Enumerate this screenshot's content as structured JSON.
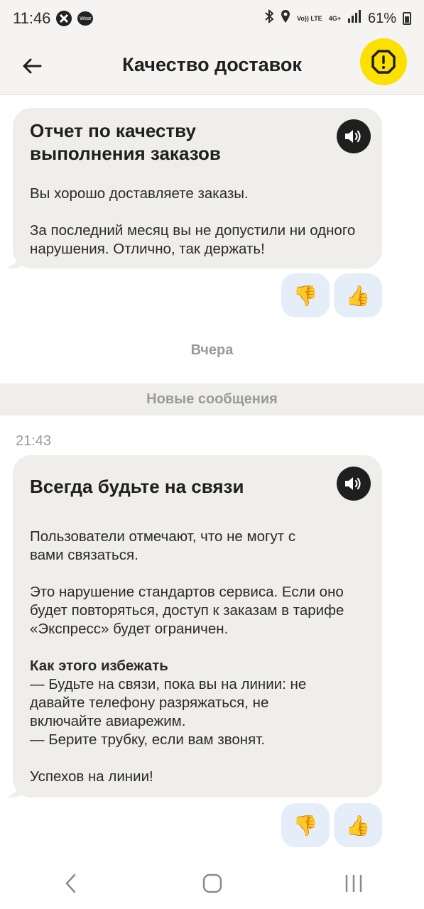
{
  "status_bar": {
    "time": "11:46",
    "wear_label": "Wear",
    "network_volte": "Vo)) LTE",
    "network_type": "4G+",
    "battery": "61%"
  },
  "header": {
    "title": "Качество доставок",
    "accent_color": "#fce000"
  },
  "messages": [
    {
      "title": "Отчет по качеству выполнения заказов",
      "paragraphs": [
        "Вы хорошо доставляете заказы.",
        "За последний месяц вы не допустили ни одного нарушения. Отлично, так держать!"
      ]
    },
    {
      "time": "21:43",
      "title": "Всегда будьте на связи",
      "paragraphs": [
        "Пользователи отмечают, что не могут с вами связаться.",
        "Это нарушение стандартов сервиса. Если оно будет повторяться, доступ к заказам в тарифе «Экспресс» будет ограничен."
      ],
      "tips_heading": "Как этого избежать",
      "tips": "— Будьте на связи, пока вы на линии: не давайте телефону разряжаться, не включайте авиарежим.\n— Берите трубку, если вам звонят.",
      "closing": "Успехов на линии!"
    }
  ],
  "reactions": {
    "dislike": "👎",
    "like": "👍"
  },
  "date_separator": "Вчера",
  "new_messages_label": "Новые сообщения"
}
